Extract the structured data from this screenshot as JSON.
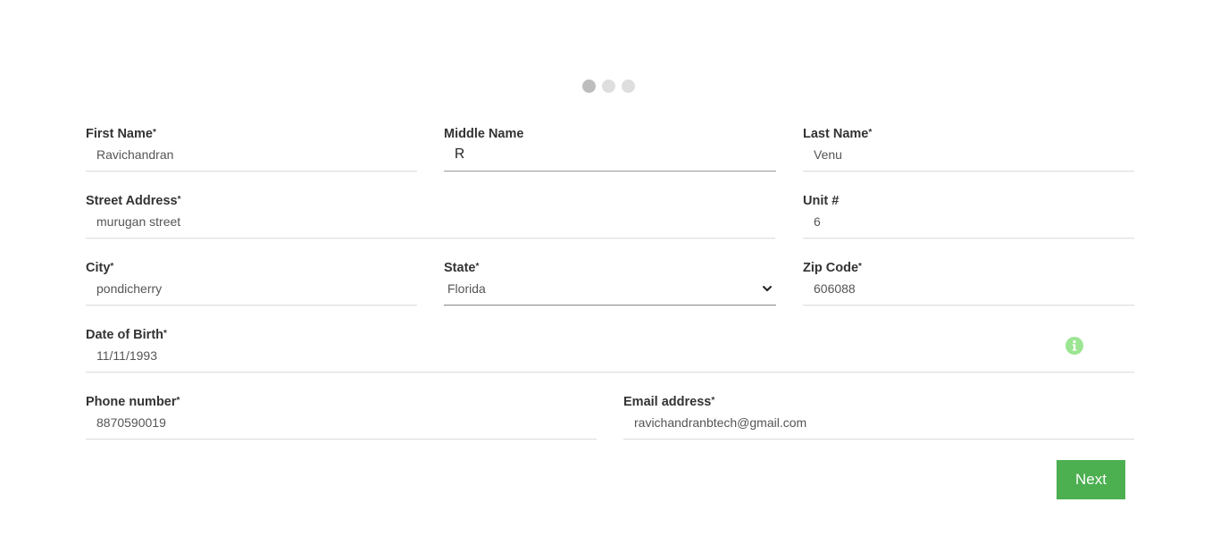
{
  "progress": {
    "total_steps": 3,
    "current_step": 1
  },
  "form": {
    "first_name": {
      "label": "First Name",
      "required_mark": "*",
      "value": "Ravichandran"
    },
    "middle_name": {
      "label": "Middle Name",
      "value": "R"
    },
    "last_name": {
      "label": "Last Name",
      "required_mark": "*",
      "value": "Venu"
    },
    "street_address": {
      "label": "Street Address",
      "required_mark": "*",
      "value": "murugan street"
    },
    "unit": {
      "label": "Unit #",
      "value": "6"
    },
    "city": {
      "label": "City",
      "required_mark": "*",
      "value": "pondicherry"
    },
    "state": {
      "label": "State",
      "required_mark": "*",
      "value": "Florida"
    },
    "zip_code": {
      "label": "Zip Code",
      "required_mark": "*",
      "value": "606088"
    },
    "dob": {
      "label": "Date of Birth",
      "required_mark": "*",
      "value": "11/11/1993"
    },
    "phone": {
      "label": "Phone number",
      "required_mark": "*",
      "value": "8870590019"
    },
    "email": {
      "label": "Email address",
      "required_mark": "*",
      "value": "ravichandranbtech@gmail.com"
    }
  },
  "actions": {
    "next_label": "Next"
  },
  "colors": {
    "accent": "#4caf50",
    "info_icon": "#9be593",
    "dot_active": "#bdbdbd",
    "dot_inactive": "#dedede"
  },
  "icons": {
    "info": "info-icon",
    "select_arrow": "chevron-down-icon"
  }
}
